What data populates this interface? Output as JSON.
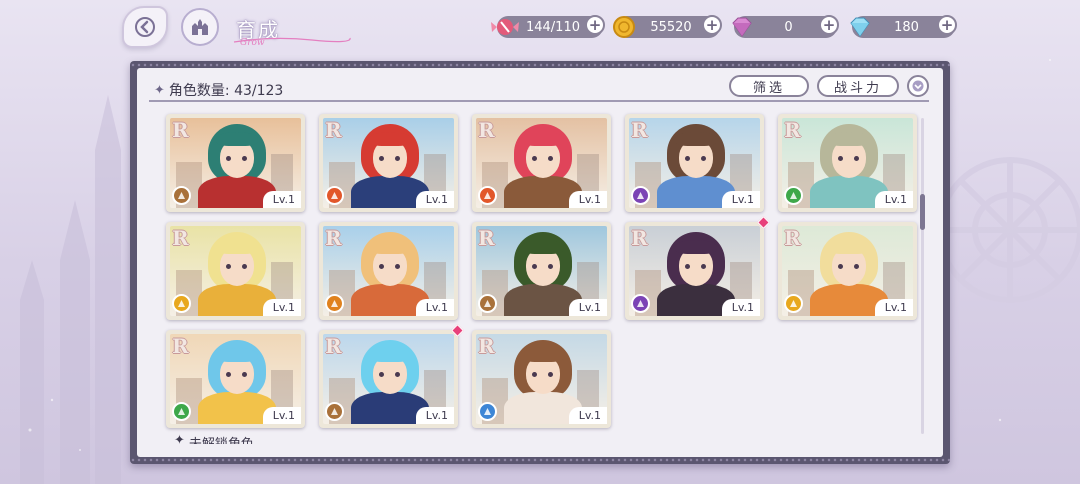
{
  "header": {
    "title": "育成",
    "title_script": "Grow"
  },
  "currencies": [
    {
      "name": "candy",
      "icon": "candy-icon",
      "value": "144/110",
      "color": "#e35a7a"
    },
    {
      "name": "coin",
      "icon": "gold-coin-icon",
      "value": "55520",
      "color": "#f0b72e"
    },
    {
      "name": "pink-gem",
      "icon": "pink-gem-icon",
      "value": "0",
      "color": "#d98ad2"
    },
    {
      "name": "blue-gem",
      "icon": "blue-gem-icon",
      "value": "180",
      "color": "#7fd0ec"
    }
  ],
  "panel": {
    "count_label": "角色数量: 43/123",
    "filter_label": "筛选",
    "sort_label": "战斗力",
    "locked_section_label": "未解锁角色"
  },
  "characters": [
    {
      "rank": "R",
      "level": "Lv.1",
      "element": "earth",
      "element_color": "#a9713a",
      "hair": "#2d7f74",
      "outfit": "#b83030",
      "sky": "#e8c09a",
      "new": false
    },
    {
      "rank": "R",
      "level": "Lv.1",
      "element": "fire",
      "element_color": "#e2572a",
      "hair": "#d63b32",
      "outfit": "#2b3f7a",
      "sky": "#a9cfe8",
      "new": false
    },
    {
      "rank": "R",
      "level": "Lv.1",
      "element": "fire",
      "element_color": "#e2572a",
      "hair": "#e0445a",
      "outfit": "#8a5a3a",
      "sky": "#e4c1a3",
      "new": false
    },
    {
      "rank": "R",
      "level": "Lv.1",
      "element": "dark",
      "element_color": "#7b43b5",
      "hair": "#6b4a38",
      "outfit": "#5f8fd0",
      "sky": "#b6d5ea",
      "new": false
    },
    {
      "rank": "R",
      "level": "Lv.1",
      "element": "wind",
      "element_color": "#3ea84a",
      "hair": "#b7b79a",
      "outfit": "#7fc3c0",
      "sky": "#c9e6d8",
      "new": false
    },
    {
      "rank": "R",
      "level": "Lv.1",
      "element": "light",
      "element_color": "#e8a81e",
      "hair": "#f0e190",
      "outfit": "#e9b03a",
      "sky": "#e9e3a6",
      "new": false
    },
    {
      "rank": "R",
      "level": "Lv.1",
      "element": "earth",
      "element_color": "#e0821e",
      "hair": "#f0c07a",
      "outfit": "#d86a3a",
      "sky": "#a9d0ea",
      "new": false
    },
    {
      "rank": "R",
      "level": "Lv.1",
      "element": "earth",
      "element_color": "#a9713a",
      "hair": "#3a5a2a",
      "outfit": "#6b5444",
      "sky": "#9fc7de",
      "new": false
    },
    {
      "rank": "R",
      "level": "Lv.1",
      "element": "dark",
      "element_color": "#7b43b5",
      "hair": "#4a2d4e",
      "outfit": "#3b2f3e",
      "sky": "#c9cfd6",
      "new": true
    },
    {
      "rank": "R",
      "level": "Lv.1",
      "element": "light",
      "element_color": "#e8a81e",
      "hair": "#f1dd9c",
      "outfit": "#e78a3a",
      "sky": "#dde9d7",
      "new": false
    },
    {
      "rank": "R",
      "level": "Lv.1",
      "element": "wind",
      "element_color": "#3ea84a",
      "hair": "#6fc7ea",
      "outfit": "#f2c24a",
      "sky": "#f0d7b7",
      "new": false
    },
    {
      "rank": "R",
      "level": "Lv.1",
      "element": "earth",
      "element_color": "#a9713a",
      "hair": "#6ed0ee",
      "outfit": "#2a3c77",
      "sky": "#bcd7ec",
      "new": true
    },
    {
      "rank": "R",
      "level": "Lv.1",
      "element": "water",
      "element_color": "#3d86d6",
      "hair": "#8c5a3a",
      "outfit": "#f1e6dc",
      "sky": "#c5d9e6",
      "new": false
    }
  ]
}
